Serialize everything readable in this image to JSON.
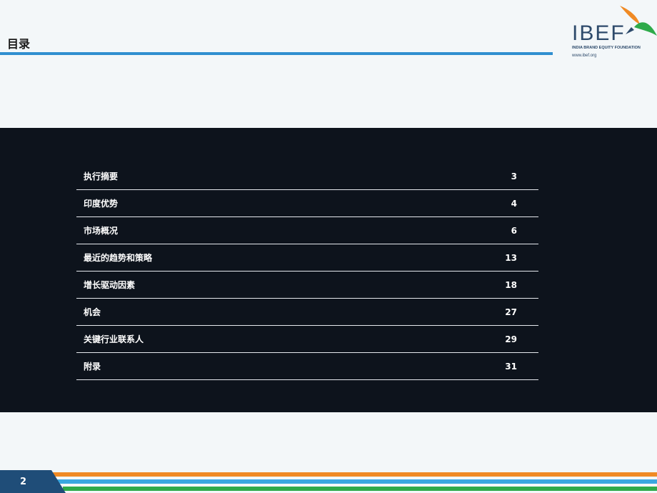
{
  "header": {
    "title": "目录"
  },
  "logo": {
    "wordmark": "IBEF",
    "subtitle": "INDIA BRAND EQUITY FOUNDATION",
    "url": "www.ibef.org",
    "icon": "bird-logo-icon",
    "colors": {
      "text": "#2d4a6b",
      "orange": "#f08a24",
      "green": "#2eaa4a"
    }
  },
  "toc": {
    "items": [
      {
        "label": "执行摘要",
        "page": "3"
      },
      {
        "label": "印度优势",
        "page": "4"
      },
      {
        "label": "市场概况",
        "page": "6"
      },
      {
        "label": "最近的趋势和策略",
        "page": "13"
      },
      {
        "label": "增长驱动因素",
        "page": "18"
      },
      {
        "label": "机会",
        "page": "27"
      },
      {
        "label": "关键行业联系人",
        "page": "29"
      },
      {
        "label": "附录",
        "page": "31"
      }
    ]
  },
  "footer": {
    "page_number": "2",
    "colors": {
      "badge": "#1f4d78",
      "orange": "#f08a24",
      "blue": "#3aa7e0",
      "green": "#2eaa4a"
    }
  }
}
